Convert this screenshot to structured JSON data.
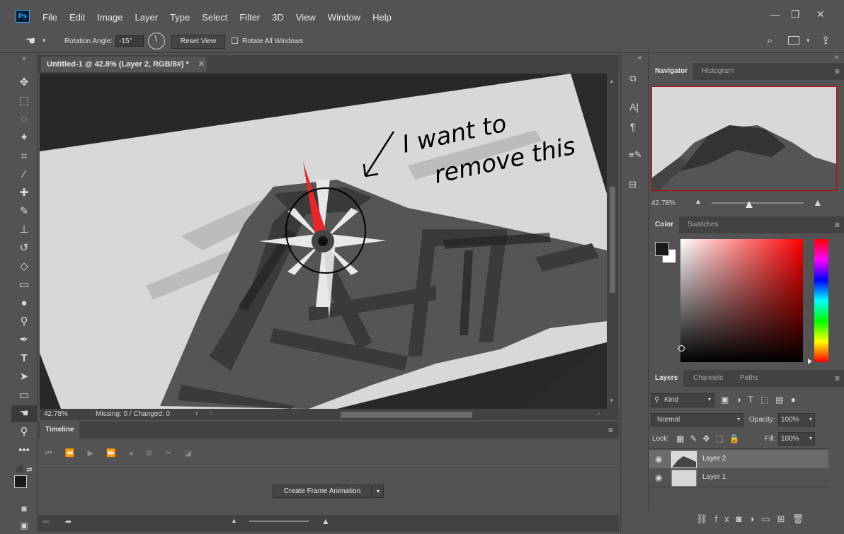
{
  "app": {
    "logo": "Ps",
    "menu": [
      "File",
      "Edit",
      "Image",
      "Layer",
      "Type",
      "Select",
      "Filter",
      "3D",
      "View",
      "Window",
      "Help"
    ],
    "window_controls": {
      "minimize": "—",
      "restore": "❐",
      "close": "✕"
    }
  },
  "options": {
    "rotation_label": "Rotation Angle:",
    "rotation_value": "-15°",
    "reset_view": "Reset View",
    "rotate_all": "Rotate All Windows"
  },
  "document": {
    "tab_title": "Untitled-1 @ 42.8% (Layer 2, RGB/8#) *",
    "annotation": [
      "I want to",
      "remove this"
    ],
    "zoom": "42.78%",
    "status": "Missing: 0 / Changed: 0"
  },
  "timeline": {
    "title": "Timeline",
    "create_button": "Create Frame Animation"
  },
  "navigator": {
    "tabs": [
      "Navigator",
      "Histogram"
    ],
    "zoom": "42.78%"
  },
  "color_panel": {
    "tabs": [
      "Color",
      "Swatches"
    ],
    "hue_color": "#ff0000"
  },
  "layers_panel": {
    "tabs": [
      "Layers",
      "Channels",
      "Paths"
    ],
    "filter_kind": "Kind",
    "blend_mode": "Normal",
    "opacity_label": "Opacity:",
    "opacity_value": "100%",
    "lock_label": "Lock:",
    "fill_label": "Fill:",
    "fill_value": "100%",
    "layers": [
      {
        "name": "Layer 2",
        "selected": true
      },
      {
        "name": "Layer 1",
        "selected": false
      }
    ]
  }
}
